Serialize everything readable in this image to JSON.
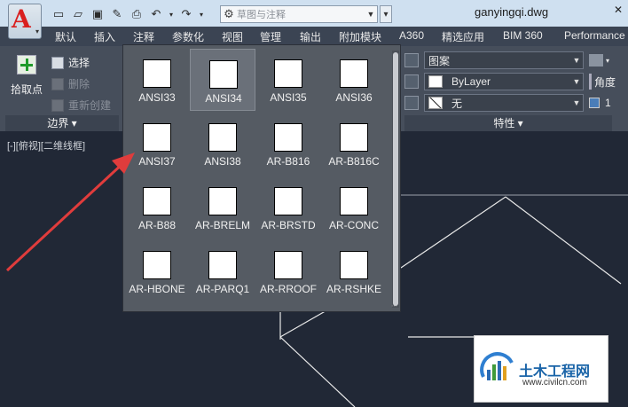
{
  "titlebar": {
    "doc_title": "ganyingqi.dwg",
    "workspace": "草图与注释",
    "qat_icons": [
      "new-icon",
      "open-icon",
      "save-icon",
      "save-as-icon",
      "print-icon",
      "undo-icon",
      "redo-icon"
    ]
  },
  "tabs": [
    "默认",
    "插入",
    "注释",
    "参数化",
    "视图",
    "管理",
    "输出",
    "附加模块",
    "A360",
    "精选应用",
    "BIM 360",
    "Performance"
  ],
  "boundary_panel": {
    "pick_points_label": "拾取点",
    "select_label": "选择",
    "remove_label": "删除",
    "recreate_label": "重新创建",
    "footer_label": "边界 ▾"
  },
  "properties_panel": {
    "pattern_label": "图案",
    "color_label": "ByLayer",
    "background_label": "无",
    "footer_label": "特性 ▾",
    "angle_label": "角度",
    "scale_value": "1"
  },
  "view_label": "[-][俯视][二维线框]",
  "hatch_gallery": {
    "selected": "ANSI34",
    "patterns": [
      {
        "name": "ANSI33",
        "pattern": "ansi33"
      },
      {
        "name": "ANSI34",
        "pattern": "ansi32"
      },
      {
        "name": "ANSI35",
        "pattern": "ansi31"
      },
      {
        "name": "ANSI36",
        "pattern": "ansi36"
      },
      {
        "name": "ANSI37",
        "pattern": "ansi37"
      },
      {
        "name": "ANSI38",
        "pattern": "ansi38"
      },
      {
        "name": "AR-B816",
        "pattern": "brick"
      },
      {
        "name": "AR-B816C",
        "pattern": "brick"
      },
      {
        "name": "AR-B88",
        "pattern": "brick2"
      },
      {
        "name": "AR-BRELM",
        "pattern": "brelm"
      },
      {
        "name": "AR-BRSTD",
        "pattern": "brick"
      },
      {
        "name": "AR-CONC",
        "pattern": "conc"
      },
      {
        "name": "AR-HBONE",
        "pattern": "hbone"
      },
      {
        "name": "AR-PARQ1",
        "pattern": "parq"
      },
      {
        "name": "AR-RROOF",
        "pattern": "rroof"
      },
      {
        "name": "AR-RSHKE",
        "pattern": "rshke"
      }
    ]
  },
  "watermark": {
    "cn": "土木工程网",
    "en": "www.civilcn.com"
  },
  "colors": {
    "titlebar_bg": "#cfe0f0",
    "ribbon_bg": "#464e5b",
    "canvas_bg": "#212836",
    "arrow": "#e03c3c"
  }
}
